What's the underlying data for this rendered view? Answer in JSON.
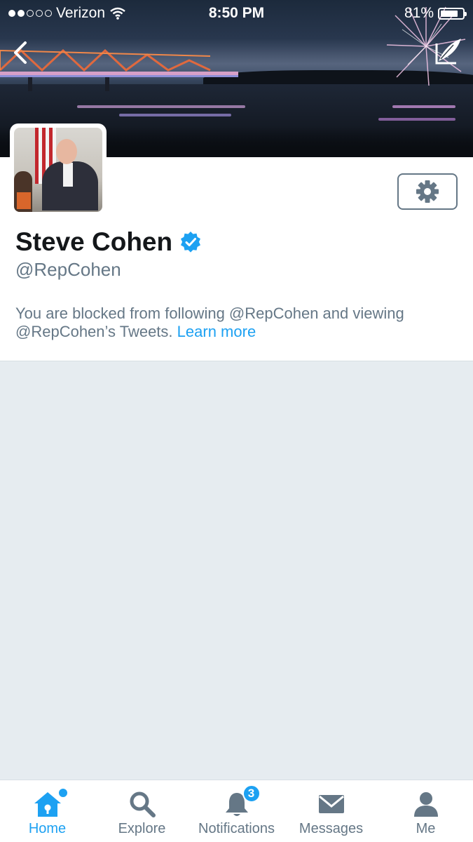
{
  "status_bar": {
    "carrier": "Verizon",
    "time": "8:50 PM",
    "battery": "81%",
    "battery_level": 0.81,
    "signal_bars_filled": 2,
    "signal_bars_total": 5
  },
  "header": {
    "back_icon": "chevron-left-icon",
    "edit_icon": "feather-compose-icon"
  },
  "profile": {
    "name": "Steve Cohen",
    "verified": true,
    "handle": "@RepCohen",
    "blocked_text": "You are blocked from following @RepCohen and viewing @RepCohen’s Tweets.",
    "learn_more": "Learn more",
    "settings_icon": "gear-icon"
  },
  "tabbar": {
    "tabs": [
      {
        "label": "Home",
        "icon": "home-icon",
        "active": true
      },
      {
        "label": "Explore",
        "icon": "search-icon",
        "active": false
      },
      {
        "label": "Notifications",
        "icon": "bell-icon",
        "active": false,
        "badge": "3"
      },
      {
        "label": "Messages",
        "icon": "envelope-icon",
        "active": false
      },
      {
        "label": "Me",
        "icon": "person-icon",
        "active": false
      }
    ]
  },
  "colors": {
    "accent": "#1da1f2",
    "text_secondary": "#657786",
    "background": "#e6ecf0"
  }
}
